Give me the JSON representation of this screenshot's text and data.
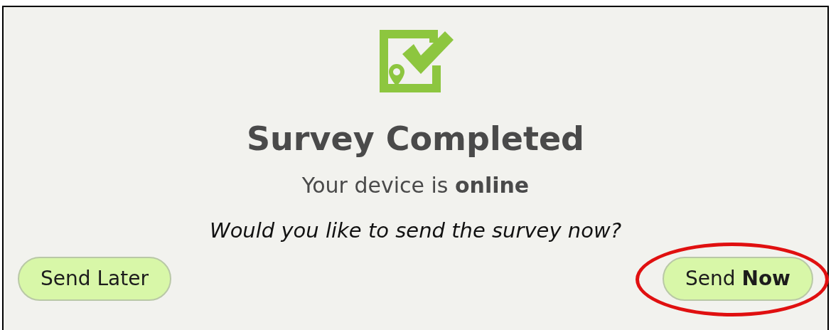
{
  "dialog": {
    "title": "Survey Completed",
    "status": "Your device is **online**",
    "question": "Would you like to send the survey now?"
  },
  "buttons": [
    {
      "label": "Send Later",
      "highlighted": false
    },
    {
      "label": "Send **Now**",
      "highlighted": true
    }
  ]
}
